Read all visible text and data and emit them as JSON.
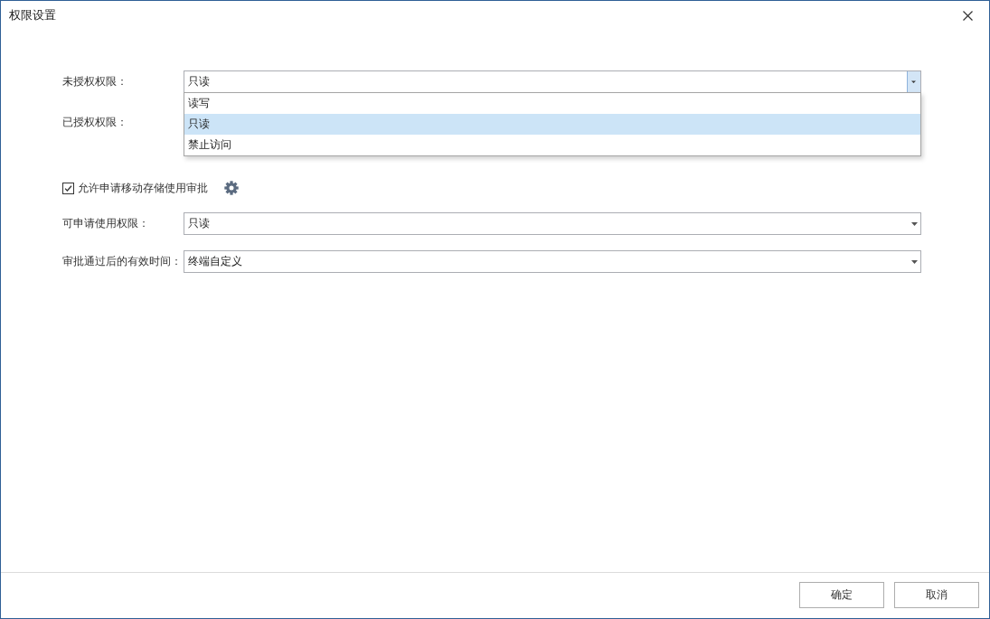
{
  "window": {
    "title": "权限设置"
  },
  "rows": [
    {
      "kind": "select",
      "label": "未授权权限：",
      "value": "只读",
      "expanded": true,
      "options": [
        {
          "label": "读写",
          "selected": false
        },
        {
          "label": "只读",
          "selected": true
        },
        {
          "label": "禁止访问",
          "selected": false
        }
      ]
    },
    {
      "kind": "label",
      "label": "已授权权限："
    },
    {
      "kind": "checkbox",
      "label": "允许申请移动存储使用审批",
      "checked": true
    },
    {
      "kind": "select",
      "label": "可申请使用权限：",
      "value": "只读",
      "expanded": false
    },
    {
      "kind": "select",
      "label": "审批通过后的有效时间：",
      "value": "终端自定义",
      "expanded": false
    }
  ],
  "buttons": [
    {
      "label": "确定"
    },
    {
      "label": "取消"
    }
  ]
}
